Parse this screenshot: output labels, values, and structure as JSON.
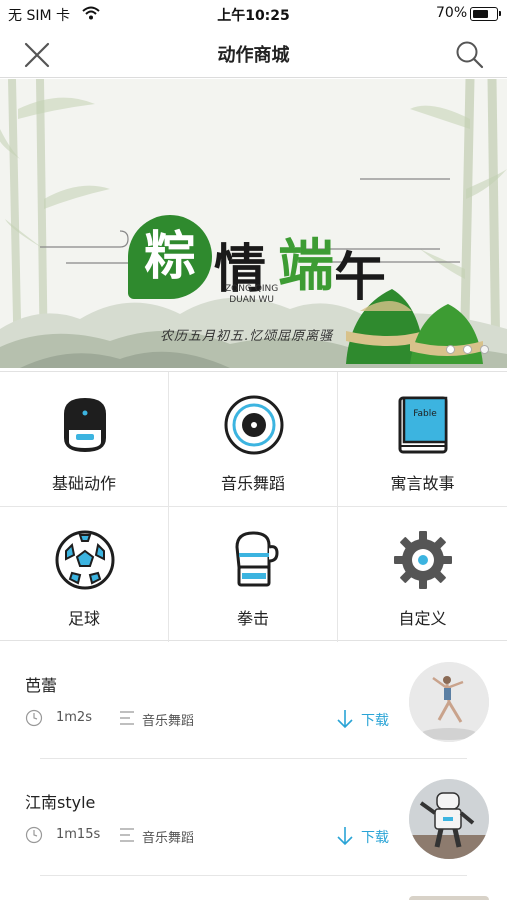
{
  "status_bar": {
    "carrier": "无 SIM 卡",
    "time": "上午10:25",
    "battery": "70%",
    "battery_level": 0.7
  },
  "nav": {
    "title": "动作商城",
    "close_icon": "close-icon",
    "search_icon": "search-icon"
  },
  "banner": {
    "chars": [
      "粽",
      "情",
      "端",
      "午"
    ],
    "pinyin_line1": "ZONG QING",
    "pinyin_line2": "DUAN WU",
    "subtitle": "农历五月初五.忆颂屈原离骚",
    "page_count": 3,
    "active_page": 2
  },
  "categories": [
    {
      "label": "基础动作",
      "icon": "robot-icon"
    },
    {
      "label": "音乐舞蹈",
      "icon": "music-disc-icon"
    },
    {
      "label": "寓言故事",
      "icon": "fable-book-icon",
      "book_text": "Fable"
    },
    {
      "label": "足球",
      "icon": "soccer-ball-icon"
    },
    {
      "label": "拳击",
      "icon": "boxing-glove-icon"
    },
    {
      "label": "自定义",
      "icon": "gear-icon"
    }
  ],
  "actions": [
    {
      "name": "芭蕾",
      "duration": "1m2s",
      "category": "音乐舞蹈",
      "download": "下载",
      "thumbnail": "ballet-dancer-thumbnail"
    },
    {
      "name": "江南style",
      "duration": "1m15s",
      "category": "音乐舞蹈",
      "download": "下载",
      "thumbnail": "robot-dancing-thumbnail"
    }
  ],
  "colors": {
    "accent": "#2aa4d6",
    "banner_green": "#2f8a2e",
    "icon_blue": "#3cb4e0"
  }
}
